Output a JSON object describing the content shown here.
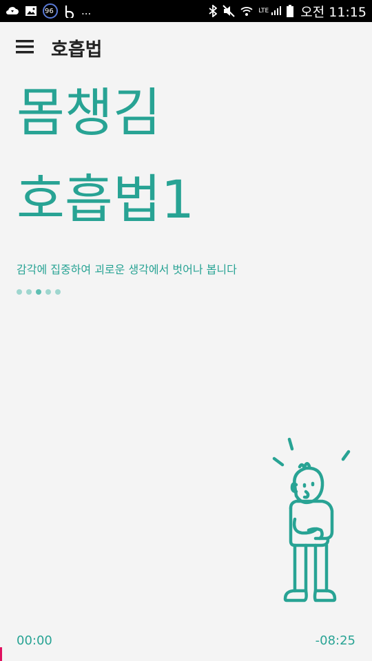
{
  "status_bar": {
    "left_icons": [
      "cloud-sync-icon",
      "image-icon",
      "badge-96-icon",
      "b-icon"
    ],
    "badge_text": "96",
    "overflow": "...",
    "right_icons": [
      "bluetooth-icon",
      "mute-icon",
      "wifi-icon",
      "lte-signal-icon",
      "battery-icon"
    ],
    "network_label": "LTE",
    "time": "오전 11:15"
  },
  "app_bar": {
    "title": "호흡법",
    "menu_icon": "hamburger-menu-icon"
  },
  "content": {
    "heading_line1": "몸챙김",
    "heading_line2": "호흡법1",
    "subtitle": "감각에 집중하여 괴로운 생각에서 벗어나 봅니다",
    "pager": {
      "total": 5,
      "current": 3
    }
  },
  "illustration": {
    "name": "person-thinking-illustration"
  },
  "player": {
    "elapsed": "00:00",
    "remaining": "-08:25",
    "progress": 0.0
  },
  "colors": {
    "accent": "#28a394",
    "background": "#f4f4f4",
    "progress_marker": "#e0115f"
  }
}
